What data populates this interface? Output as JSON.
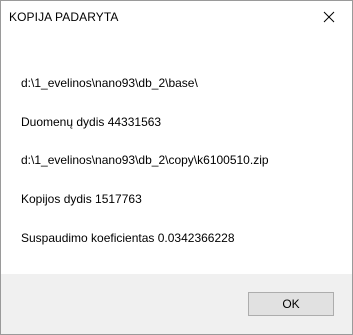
{
  "window": {
    "title": "KOPIJA PADARYTA",
    "close_icon": "close-icon"
  },
  "content": {
    "lines": [
      "d:\\1_evelinos\\nano93\\db_2\\base\\",
      "Duomenų dydis  44331563",
      "d:\\1_evelinos\\nano93\\db_2\\copy\\k6100510.zip",
      "Kopijos dydis  1517763",
      "Suspaudimo koeficientas  0.0342366228"
    ]
  },
  "footer": {
    "ok_label": "OK"
  }
}
